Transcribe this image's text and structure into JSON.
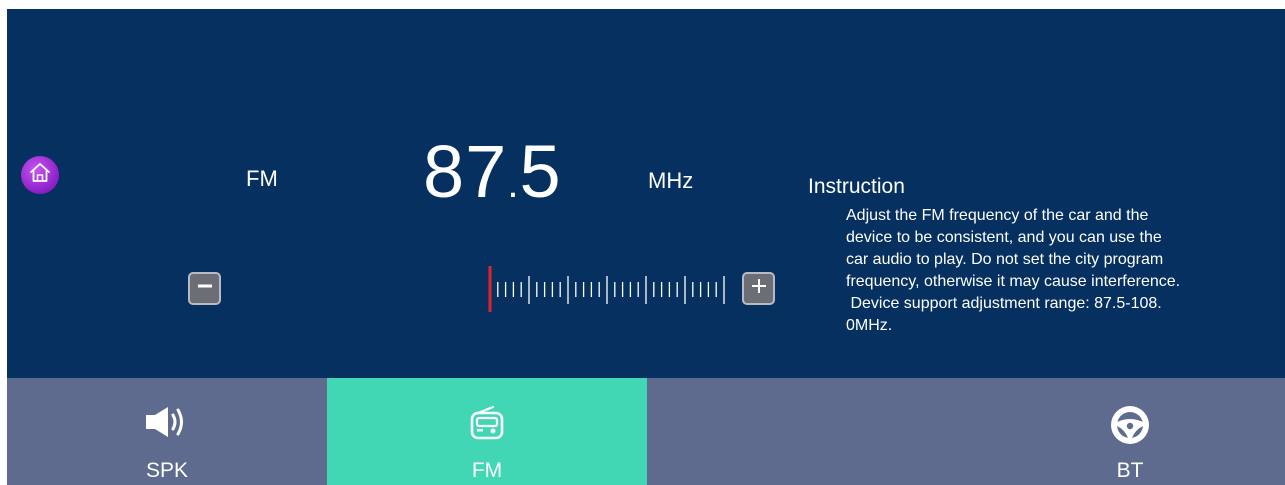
{
  "header": {
    "band": "FM",
    "frequency_int": "87",
    "frequency_dot": ".",
    "frequency_dec": "5",
    "unit": "MHz"
  },
  "tuner": {
    "range_min": 87.5,
    "range_max": 108.0,
    "current": 87.5,
    "needle_color": "#e0232e"
  },
  "instruction": {
    "title": "Instruction",
    "lines": [
      "Adjust the FM frequency of the car and the",
      "device to be consistent, and you can use the",
      "car audio to play. Do not set the city program",
      "frequency, otherwise it may cause interference.",
      " Device support adjustment range: 87.5-108.",
      "0MHz."
    ]
  },
  "tabs": [
    {
      "label": "SPK",
      "icon": "speaker-icon",
      "active": false
    },
    {
      "label": "FM",
      "icon": "radio-icon",
      "active": true
    },
    {
      "label": "BT",
      "icon": "steering-wheel-icon",
      "active": false
    }
  ],
  "icons": {
    "home": "home-icon",
    "minus": "minus-icon",
    "plus": "plus-icon"
  },
  "colors": {
    "background": "#06305f",
    "tabbar": "#5f6b8e",
    "active_tab": "#41d6b4",
    "home_button": "#a02ee0"
  }
}
